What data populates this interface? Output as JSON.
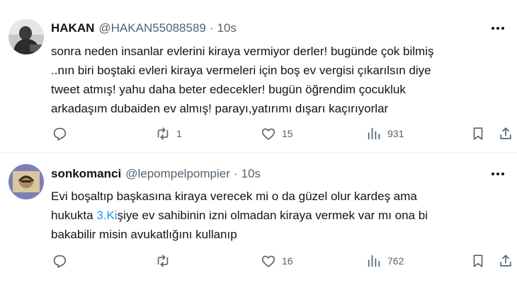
{
  "tweets": [
    {
      "display_name": "HAKAN",
      "handle": "@HAKAN55088589",
      "separator": "·",
      "time": "10s",
      "lines": [
        "sonra neden insanlar evlerini kiraya vermiyor derler! bugünde çok bilmiş",
        "..nın biri boştaki evleri kiraya vermeleri için boş ev vergisi çıkarılsın diye",
        "tweet atmış! yahu daha beter edecekler! bugün öğrendim çocukluk",
        "arkadaşım dubaiden ev almış! parayı,yatırımı dışarı kaçırıyorlar"
      ],
      "reply_count": "",
      "repost_count": "1",
      "like_count": "15",
      "view_count": "931",
      "avatar_icon": "user-photo"
    },
    {
      "display_name": "sonkomanci",
      "handle": "@lepompelpompier",
      "separator": "·",
      "time": "10s",
      "line1": "Evi boşaltıp başkasına kiraya verecek mi o da güzel olur kardeş ama",
      "line2_before": "hukukta ",
      "line2_link": "3.Ki",
      "line2_after": "şiye ev sahibinin izni olmadan kiraya vermek var mı ona bi",
      "line3": "bakabilir misin avukatlığını kullanıp",
      "reply_count": "",
      "repost_count": "",
      "like_count": "16",
      "view_count": "762",
      "avatar_icon": "user-photo"
    }
  ],
  "colors": {
    "text": "#0f1419",
    "secondary": "#536471",
    "link": "#1d9bf0",
    "divider": "#eff3f4"
  }
}
